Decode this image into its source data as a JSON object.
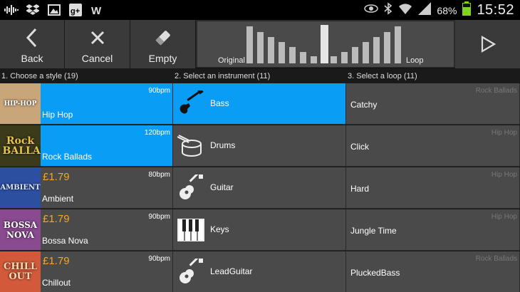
{
  "status_bar": {
    "battery_percent": "68%",
    "time": "15:52",
    "left_icons": [
      "voicemail-wave-icon",
      "dropbox-icon",
      "gallery-icon",
      "google-plus-icon",
      "word-icon"
    ],
    "right_icons": [
      "eye-icon",
      "bluetooth-icon",
      "wifi-icon",
      "signal-icon",
      "battery-icon"
    ]
  },
  "toolbar": {
    "back_label": "Back",
    "cancel_label": "Cancel",
    "empty_label": "Empty",
    "crossfade": {
      "left_label": "Original",
      "right_label": "Loop"
    }
  },
  "columns": {
    "styles_header": "1. Choose a style (19)",
    "instruments_header": "2. Select an instrument (11)",
    "loops_header": "3. Select a loop (11)"
  },
  "styles": [
    {
      "name": "Hip Hop",
      "bpm": "90bpm",
      "price": "",
      "selected": true,
      "thumb_text": "HIP-HOP",
      "thumb_color": "#c9a57a"
    },
    {
      "name": "Rock Ballads",
      "bpm": "120bpm",
      "price": "",
      "selected": true,
      "thumb_text": "Rock BALLADS",
      "thumb_color": "#3b3a1a"
    },
    {
      "name": "Ambient",
      "bpm": "80bpm",
      "price": "£1.79",
      "selected": false,
      "thumb_text": "AMBIENT",
      "thumb_color": "#2c4fa0"
    },
    {
      "name": "Bossa Nova",
      "bpm": "90bpm",
      "price": "£1.79",
      "selected": false,
      "thumb_text": "BOSSA NOVA",
      "thumb_color": "#8a4a90"
    },
    {
      "name": "Chillout",
      "bpm": "90bpm",
      "price": "£1.79",
      "selected": false,
      "thumb_text": "CHILL OUT",
      "thumb_color": "#d25a3a"
    }
  ],
  "instruments": [
    {
      "name": "Bass",
      "icon": "bass-guitar-icon",
      "selected": true
    },
    {
      "name": "Drums",
      "icon": "drum-icon",
      "selected": false
    },
    {
      "name": "Guitar",
      "icon": "acoustic-guitar-icon",
      "selected": false
    },
    {
      "name": "Keys",
      "icon": "piano-keys-icon",
      "selected": false
    },
    {
      "name": "LeadGuitar",
      "icon": "acoustic-guitar-icon",
      "selected": false
    }
  ],
  "loops": [
    {
      "name": "Catchy",
      "style": "Rock Ballads"
    },
    {
      "name": "Click",
      "style": "Hip Hop"
    },
    {
      "name": "Hard",
      "style": "Hip Hop"
    },
    {
      "name": "Jungle Time",
      "style": "Hip Hop"
    },
    {
      "name": "PluckedBass",
      "style": "Rock Ballads"
    }
  ],
  "colors": {
    "accent": "#0a9df5",
    "price": "#f5a623",
    "row_bg": "#4a4a4a"
  }
}
